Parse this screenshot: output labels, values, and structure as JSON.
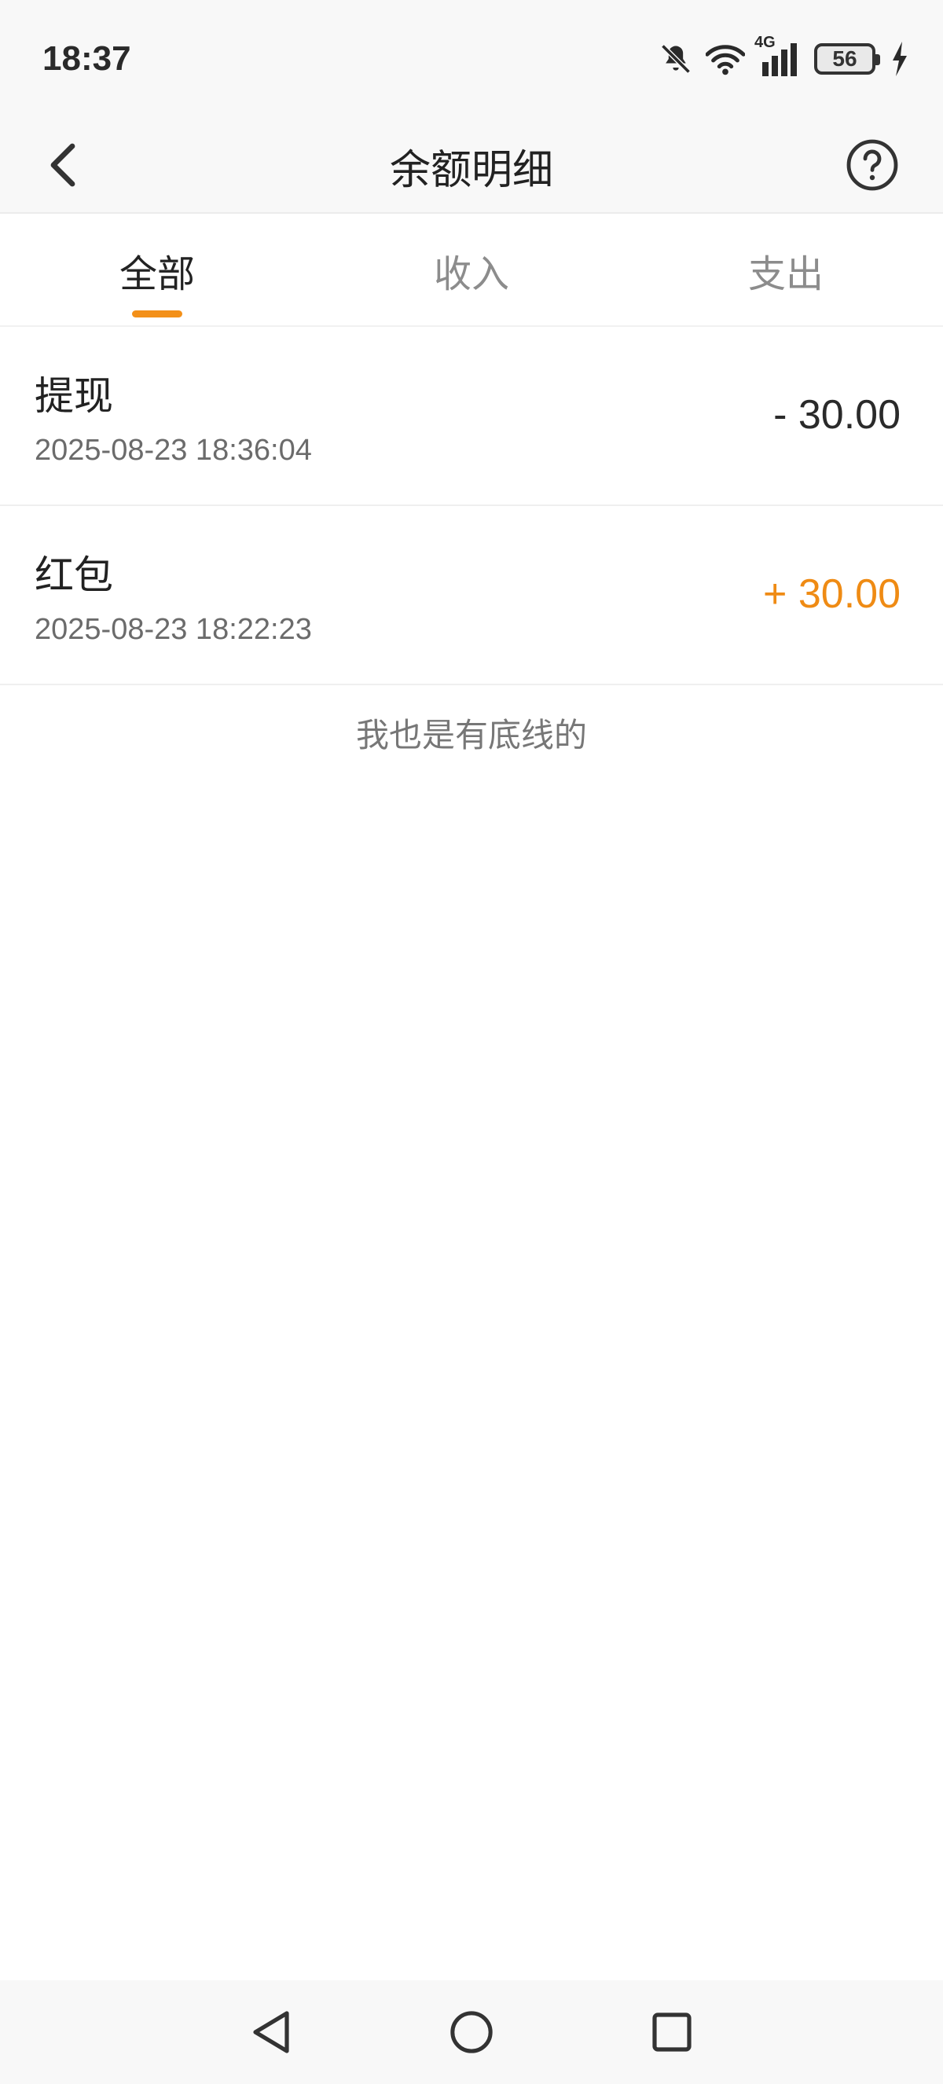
{
  "status_bar": {
    "time": "18:37",
    "network": "4G",
    "battery_level": "56",
    "icons": [
      "bell-muted-icon",
      "wifi-icon",
      "signal-icon",
      "battery-icon",
      "charging-icon"
    ]
  },
  "header": {
    "title": "余额明细",
    "back_icon": "chevron-left-icon",
    "help_icon": "question-circle-icon"
  },
  "tabs": [
    {
      "label": "全部",
      "active": true
    },
    {
      "label": "收入",
      "active": false
    },
    {
      "label": "支出",
      "active": false
    }
  ],
  "records": [
    {
      "title": "提现",
      "time": "2025-08-23 18:36:04",
      "amount": "- 30.00",
      "kind": "expense"
    },
    {
      "title": "红包",
      "time": "2025-08-23 18:22:23",
      "amount": "+ 30.00",
      "kind": "income"
    }
  ],
  "footer_text": "我也是有底线的",
  "colors": {
    "accent": "#f39019",
    "income": "#ef8b14",
    "expense": "#2a2a2a"
  },
  "nav_bar": {
    "icons": [
      "back-triangle-icon",
      "home-circle-icon",
      "recents-square-icon"
    ]
  }
}
